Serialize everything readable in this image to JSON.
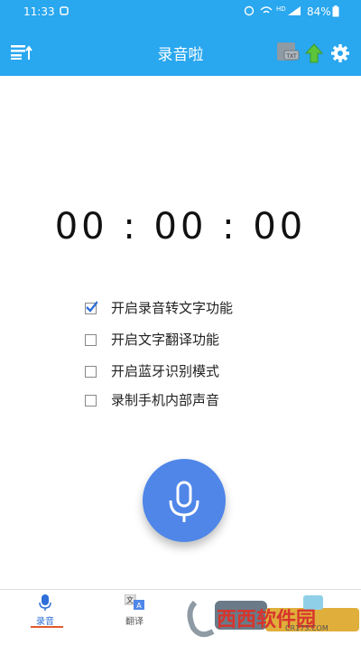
{
  "statusbar": {
    "time": "11:33",
    "battery": "84%"
  },
  "appbar": {
    "title": "录音啦",
    "left_icon": "menu-sort-icon",
    "right_icons": [
      "file-icon",
      "upload-arrow-icon",
      "gear-icon"
    ]
  },
  "timer": "00 : 00 : 00",
  "options": [
    {
      "label": "开启录音转文字功能",
      "checked": true
    },
    {
      "label": "开启文字翻译功能",
      "checked": false
    },
    {
      "label": "开启蓝牙识别模式",
      "checked": false
    },
    {
      "label": "录制手机内部声音",
      "checked": false
    }
  ],
  "tabs": [
    {
      "label": "录音",
      "icon": "mic-icon"
    },
    {
      "label": "翻译",
      "icon": "translate-icon"
    }
  ],
  "watermark": {
    "text": "西西软件园",
    "url": "CR173.COM"
  },
  "colors": {
    "primary": "#29a7ef",
    "mic": "#4f86e8",
    "tab_active": "#2e6fd8",
    "tab_underline": "#e05a2a"
  }
}
